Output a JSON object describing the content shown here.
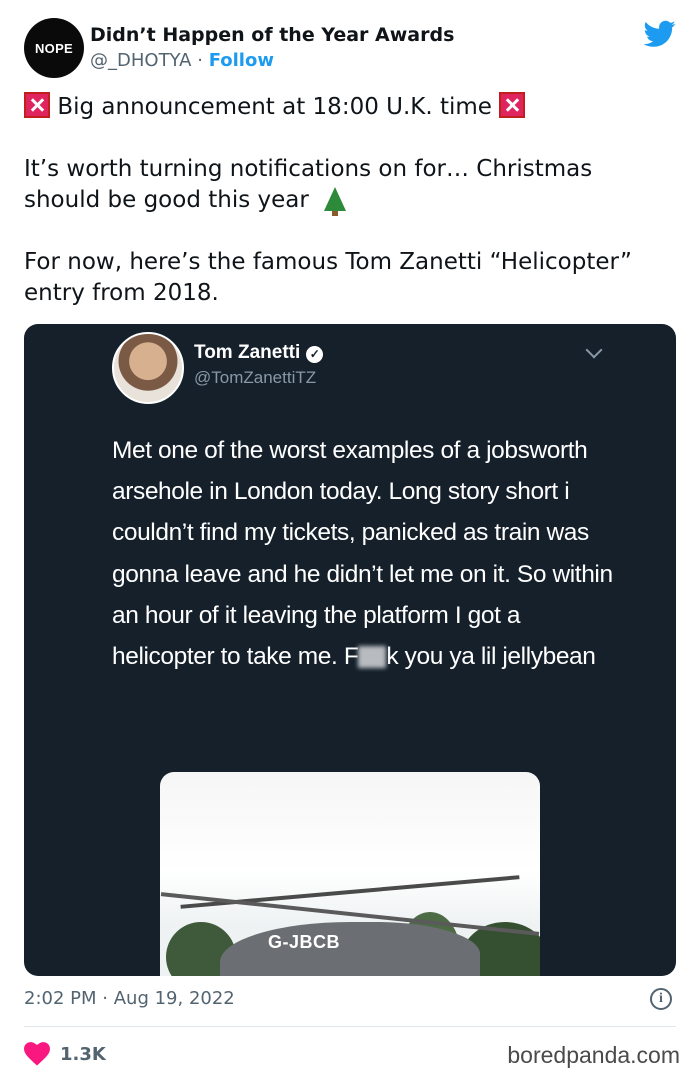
{
  "header": {
    "avatar_text": "NOPE",
    "display_name": "Didn’t Happen of the Year Awards",
    "handle": "@_DHOTYA",
    "separator": "·",
    "follow_label": "Follow",
    "platform_icon": "twitter-bird-icon"
  },
  "tweet": {
    "line1": "Big announcement at 18:00 U.K. time",
    "line2": "It’s worth turning notifications on for… Christmas should be good this year",
    "line3": "For now, here’s the famous Tom Zanetti “Helicopter” entry from 2018.",
    "icons": [
      "siren-icon",
      "christmas-tree-icon"
    ]
  },
  "embedded": {
    "name": "Tom Zanetti",
    "handle": "@TomZanettiTZ",
    "text_before": "Met one of the worst examples of a jobsworth arsehole in London today. Long story short i couldn’t find my tickets, panicked as train was gonna leave and he didn’t let me on it. So within an hour of it leaving the platform I got a helicopter to take me. F",
    "text_after": "k you ya lil jellybean",
    "photo_registration": "G-JBCB"
  },
  "footer": {
    "time": "2:02 PM",
    "separator": "·",
    "date": "Aug 19, 2022",
    "like_count": "1.3K",
    "info_symbol": "i"
  },
  "watermark": "boredpanda.com",
  "colors": {
    "accent": "#1d9bf0",
    "embed_bg": "#15202b",
    "heart": "#f91880"
  }
}
